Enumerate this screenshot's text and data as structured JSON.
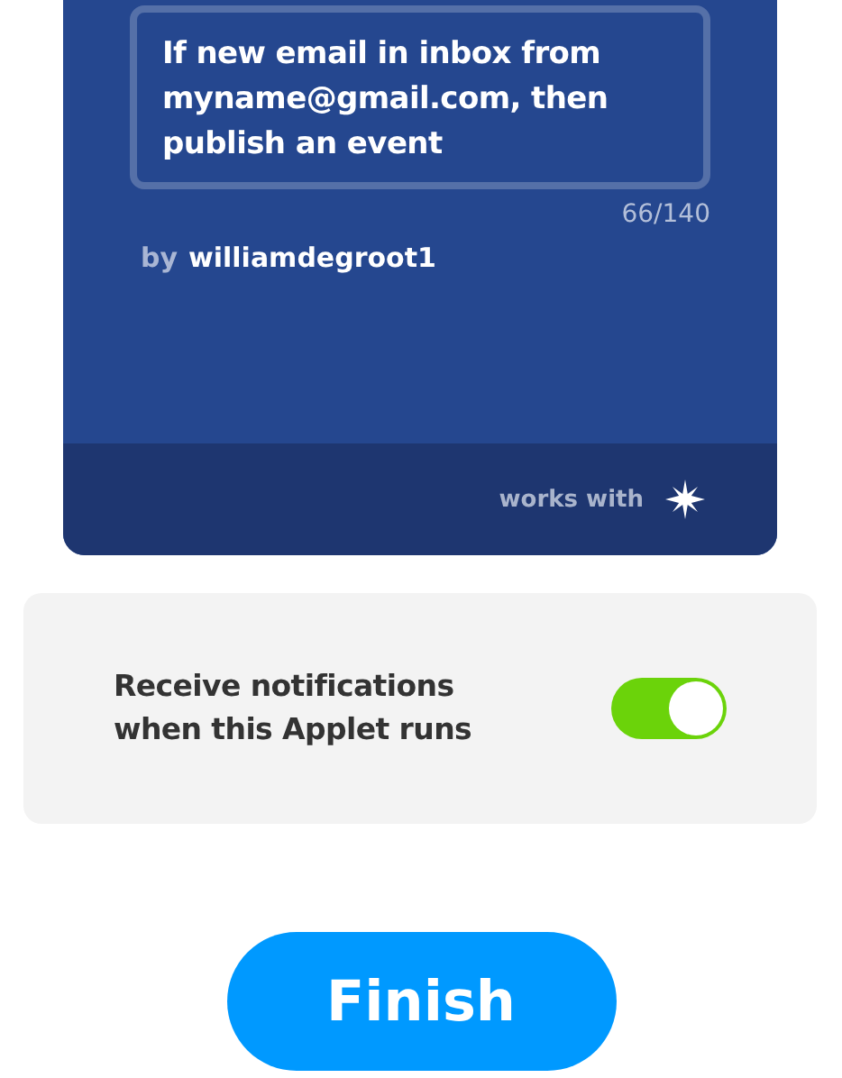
{
  "applet": {
    "description": "If new email in inbox from myname@gmail.com, then publish an event",
    "counter": "66/140",
    "author_prefix": "by",
    "author": "williamdegroot1",
    "works_with": "works with"
  },
  "notification": {
    "label": "Receive notifications when this Applet runs",
    "on": true
  },
  "finish_button": "Finish"
}
